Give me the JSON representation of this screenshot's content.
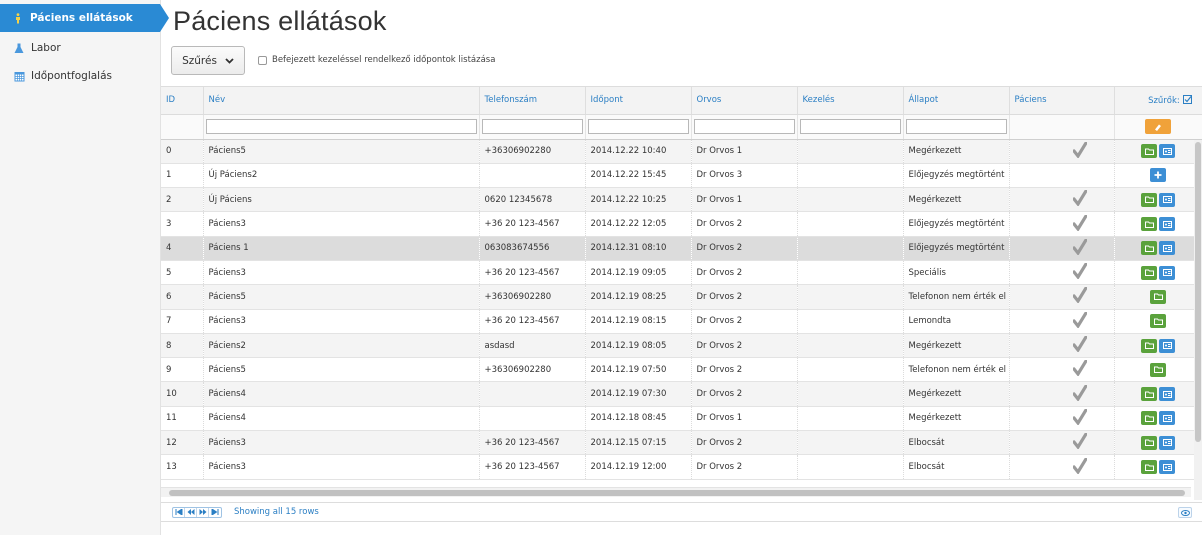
{
  "sidebar": {
    "items": [
      {
        "label": "Páciens ellátások",
        "icon": "wheelchair-icon",
        "active": true
      },
      {
        "label": "Labor",
        "icon": "flask-icon",
        "active": false
      },
      {
        "label": "Időpontfoglalás",
        "icon": "calendar-icon",
        "active": false
      }
    ]
  },
  "main": {
    "title": "Páciens ellátások",
    "filter_button": "Szűrés",
    "completed_checkbox_label": "Befejezett kezeléssel rendelkező időpontok listázása"
  },
  "table": {
    "columns": [
      "ID",
      "Név",
      "Telefonszám",
      "Időpont",
      "Orvos",
      "Kezelés",
      "Állapot",
      "Páciens",
      "Szűrők:"
    ],
    "rows": [
      {
        "id": "0",
        "name": "Páciens5",
        "phone": "+36306902280",
        "time": "2014.12.22 10:40",
        "doctor": "Dr Orvos 1",
        "treatment": "",
        "status": "Megérkezett",
        "patient_check": true,
        "actions": [
          "folder",
          "card"
        ]
      },
      {
        "id": "1",
        "name": "Új Páciens2",
        "phone": "",
        "time": "2014.12.22 15:45",
        "doctor": "Dr Orvos 3",
        "treatment": "",
        "status": "Előjegyzés megtörtént",
        "patient_check": false,
        "actions": [
          "plus"
        ]
      },
      {
        "id": "2",
        "name": "Új Páciens",
        "phone": "0620 12345678",
        "time": "2014.12.22 10:25",
        "doctor": "Dr Orvos 1",
        "treatment": "",
        "status": "Megérkezett",
        "patient_check": true,
        "actions": [
          "folder",
          "card"
        ]
      },
      {
        "id": "3",
        "name": "Páciens3",
        "phone": "+36 20 123-4567",
        "time": "2014.12.22 12:05",
        "doctor": "Dr Orvos 2",
        "treatment": "",
        "status": "Előjegyzés megtörtént",
        "patient_check": true,
        "actions": [
          "folder",
          "card"
        ]
      },
      {
        "id": "4",
        "name": "Páciens 1",
        "phone": "063083674556",
        "time": "2014.12.31 08:10",
        "doctor": "Dr Orvos 2",
        "treatment": "",
        "status": "Előjegyzés megtörtént",
        "patient_check": true,
        "actions": [
          "folder",
          "card"
        ]
      },
      {
        "id": "5",
        "name": "Páciens3",
        "phone": "+36 20 123-4567",
        "time": "2014.12.19 09:05",
        "doctor": "Dr Orvos 2",
        "treatment": "",
        "status": "Speciális",
        "patient_check": true,
        "actions": [
          "folder",
          "card"
        ]
      },
      {
        "id": "6",
        "name": "Páciens5",
        "phone": "+36306902280",
        "time": "2014.12.19 08:25",
        "doctor": "Dr Orvos 2",
        "treatment": "",
        "status": "Telefonon nem érték el",
        "patient_check": true,
        "actions": [
          "folder"
        ]
      },
      {
        "id": "7",
        "name": "Páciens3",
        "phone": "+36 20 123-4567",
        "time": "2014.12.19 08:15",
        "doctor": "Dr Orvos 2",
        "treatment": "",
        "status": "Lemondta",
        "patient_check": true,
        "actions": [
          "folder"
        ]
      },
      {
        "id": "8",
        "name": "Páciens2",
        "phone": "asdasd",
        "time": "2014.12.19 08:05",
        "doctor": "Dr Orvos 2",
        "treatment": "",
        "status": "Megérkezett",
        "patient_check": true,
        "actions": [
          "folder",
          "card"
        ]
      },
      {
        "id": "9",
        "name": "Páciens5",
        "phone": "+36306902280",
        "time": "2014.12.19 07:50",
        "doctor": "Dr Orvos 2",
        "treatment": "",
        "status": "Telefonon nem érték el",
        "patient_check": true,
        "actions": [
          "folder"
        ]
      },
      {
        "id": "10",
        "name": "Páciens4",
        "phone": "",
        "time": "2014.12.19 07:30",
        "doctor": "Dr Orvos 2",
        "treatment": "",
        "status": "Megérkezett",
        "patient_check": true,
        "actions": [
          "folder",
          "card"
        ]
      },
      {
        "id": "11",
        "name": "Páciens4",
        "phone": "",
        "time": "2014.12.18 08:45",
        "doctor": "Dr Orvos 1",
        "treatment": "",
        "status": "Megérkezett",
        "patient_check": true,
        "actions": [
          "folder",
          "card"
        ]
      },
      {
        "id": "12",
        "name": "Páciens3",
        "phone": "+36 20 123-4567",
        "time": "2014.12.15 07:15",
        "doctor": "Dr Orvos 2",
        "treatment": "",
        "status": "Elbocsát",
        "patient_check": true,
        "actions": [
          "folder",
          "card"
        ]
      },
      {
        "id": "13",
        "name": "Páciens3",
        "phone": "+36 20 123-4567",
        "time": "2014.12.19 12:00",
        "doctor": "Dr Orvos 2",
        "treatment": "",
        "status": "Elbocsát",
        "patient_check": true,
        "actions": [
          "folder",
          "card"
        ]
      }
    ],
    "selected_row": 4
  },
  "footer": {
    "row_count_text": "Showing all 15 rows"
  },
  "colors": {
    "accent": "#2a8ad4",
    "header_text": "#2b7fc4",
    "action_green": "#5aa23c",
    "action_blue": "#3d8fd5",
    "clear_orange": "#f0a23a"
  }
}
